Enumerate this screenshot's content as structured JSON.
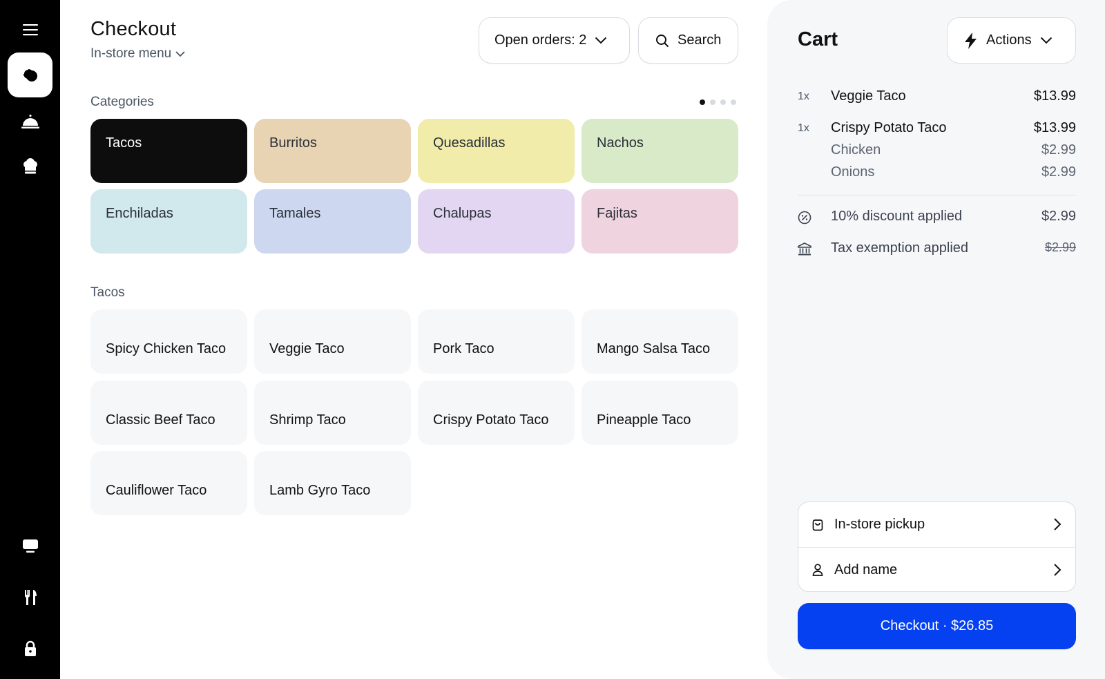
{
  "sidebar": {
    "items": [
      {
        "icon": "hamburger-menu-icon"
      },
      {
        "icon": "pos-logo-icon",
        "active": true
      },
      {
        "icon": "cloche-icon"
      },
      {
        "icon": "chef-hat-icon"
      },
      {
        "icon": "monitor-icon"
      },
      {
        "icon": "utensils-icon"
      },
      {
        "icon": "lock-icon"
      }
    ]
  },
  "header": {
    "title": "Checkout",
    "menu_selector": "In-store menu",
    "open_orders": "Open orders: 2",
    "search": "Search"
  },
  "categories": {
    "label": "Categories",
    "page_count": 4,
    "active_page": 0,
    "items": [
      {
        "label": "Tacos",
        "color": "#0d0d0d",
        "text_color": "#ffffff",
        "selected": true
      },
      {
        "label": "Burritos",
        "color": "#e8d4b2"
      },
      {
        "label": "Quesadillas",
        "color": "#f2ecaa"
      },
      {
        "label": "Nachos",
        "color": "#d9eac8"
      },
      {
        "label": "Enchiladas",
        "color": "#d1e8ec"
      },
      {
        "label": "Tamales",
        "color": "#cdd8f0"
      },
      {
        "label": "Chalupas",
        "color": "#e3d6f3"
      },
      {
        "label": "Fajitas",
        "color": "#efd3df"
      }
    ]
  },
  "menu": {
    "section_label": "Tacos",
    "items": [
      "Spicy Chicken Taco",
      "Veggie Taco",
      "Pork Taco",
      "Mango Salsa Taco",
      "Classic Beef Taco",
      "Shrimp Taco",
      "Crispy Potato Taco",
      "Pineapple Taco",
      "Cauliflower Taco",
      "Lamb Gyro Taco"
    ]
  },
  "cart": {
    "title": "Cart",
    "actions_label": "Actions",
    "lines": [
      {
        "qty": "1x",
        "name": "Veggie Taco",
        "price": "$13.99"
      },
      {
        "qty": "1x",
        "name": "Crispy Potato Taco",
        "price": "$13.99",
        "modifiers": [
          {
            "name": "Chicken",
            "price": "$2.99"
          },
          {
            "name": "Onions",
            "price": "$2.99"
          }
        ]
      }
    ],
    "adjustments": [
      {
        "icon": "discount-icon",
        "label": "10% discount applied",
        "value": "$2.99"
      },
      {
        "icon": "bank-icon",
        "label": "Tax exemption applied",
        "value": "$2.99",
        "struck": true
      }
    ],
    "options": [
      {
        "icon": "bag-icon",
        "label": "In-store pickup"
      },
      {
        "icon": "user-icon",
        "label": "Add name"
      }
    ],
    "checkout_label": "Checkout · $26.85",
    "accent": "#0541f0"
  }
}
